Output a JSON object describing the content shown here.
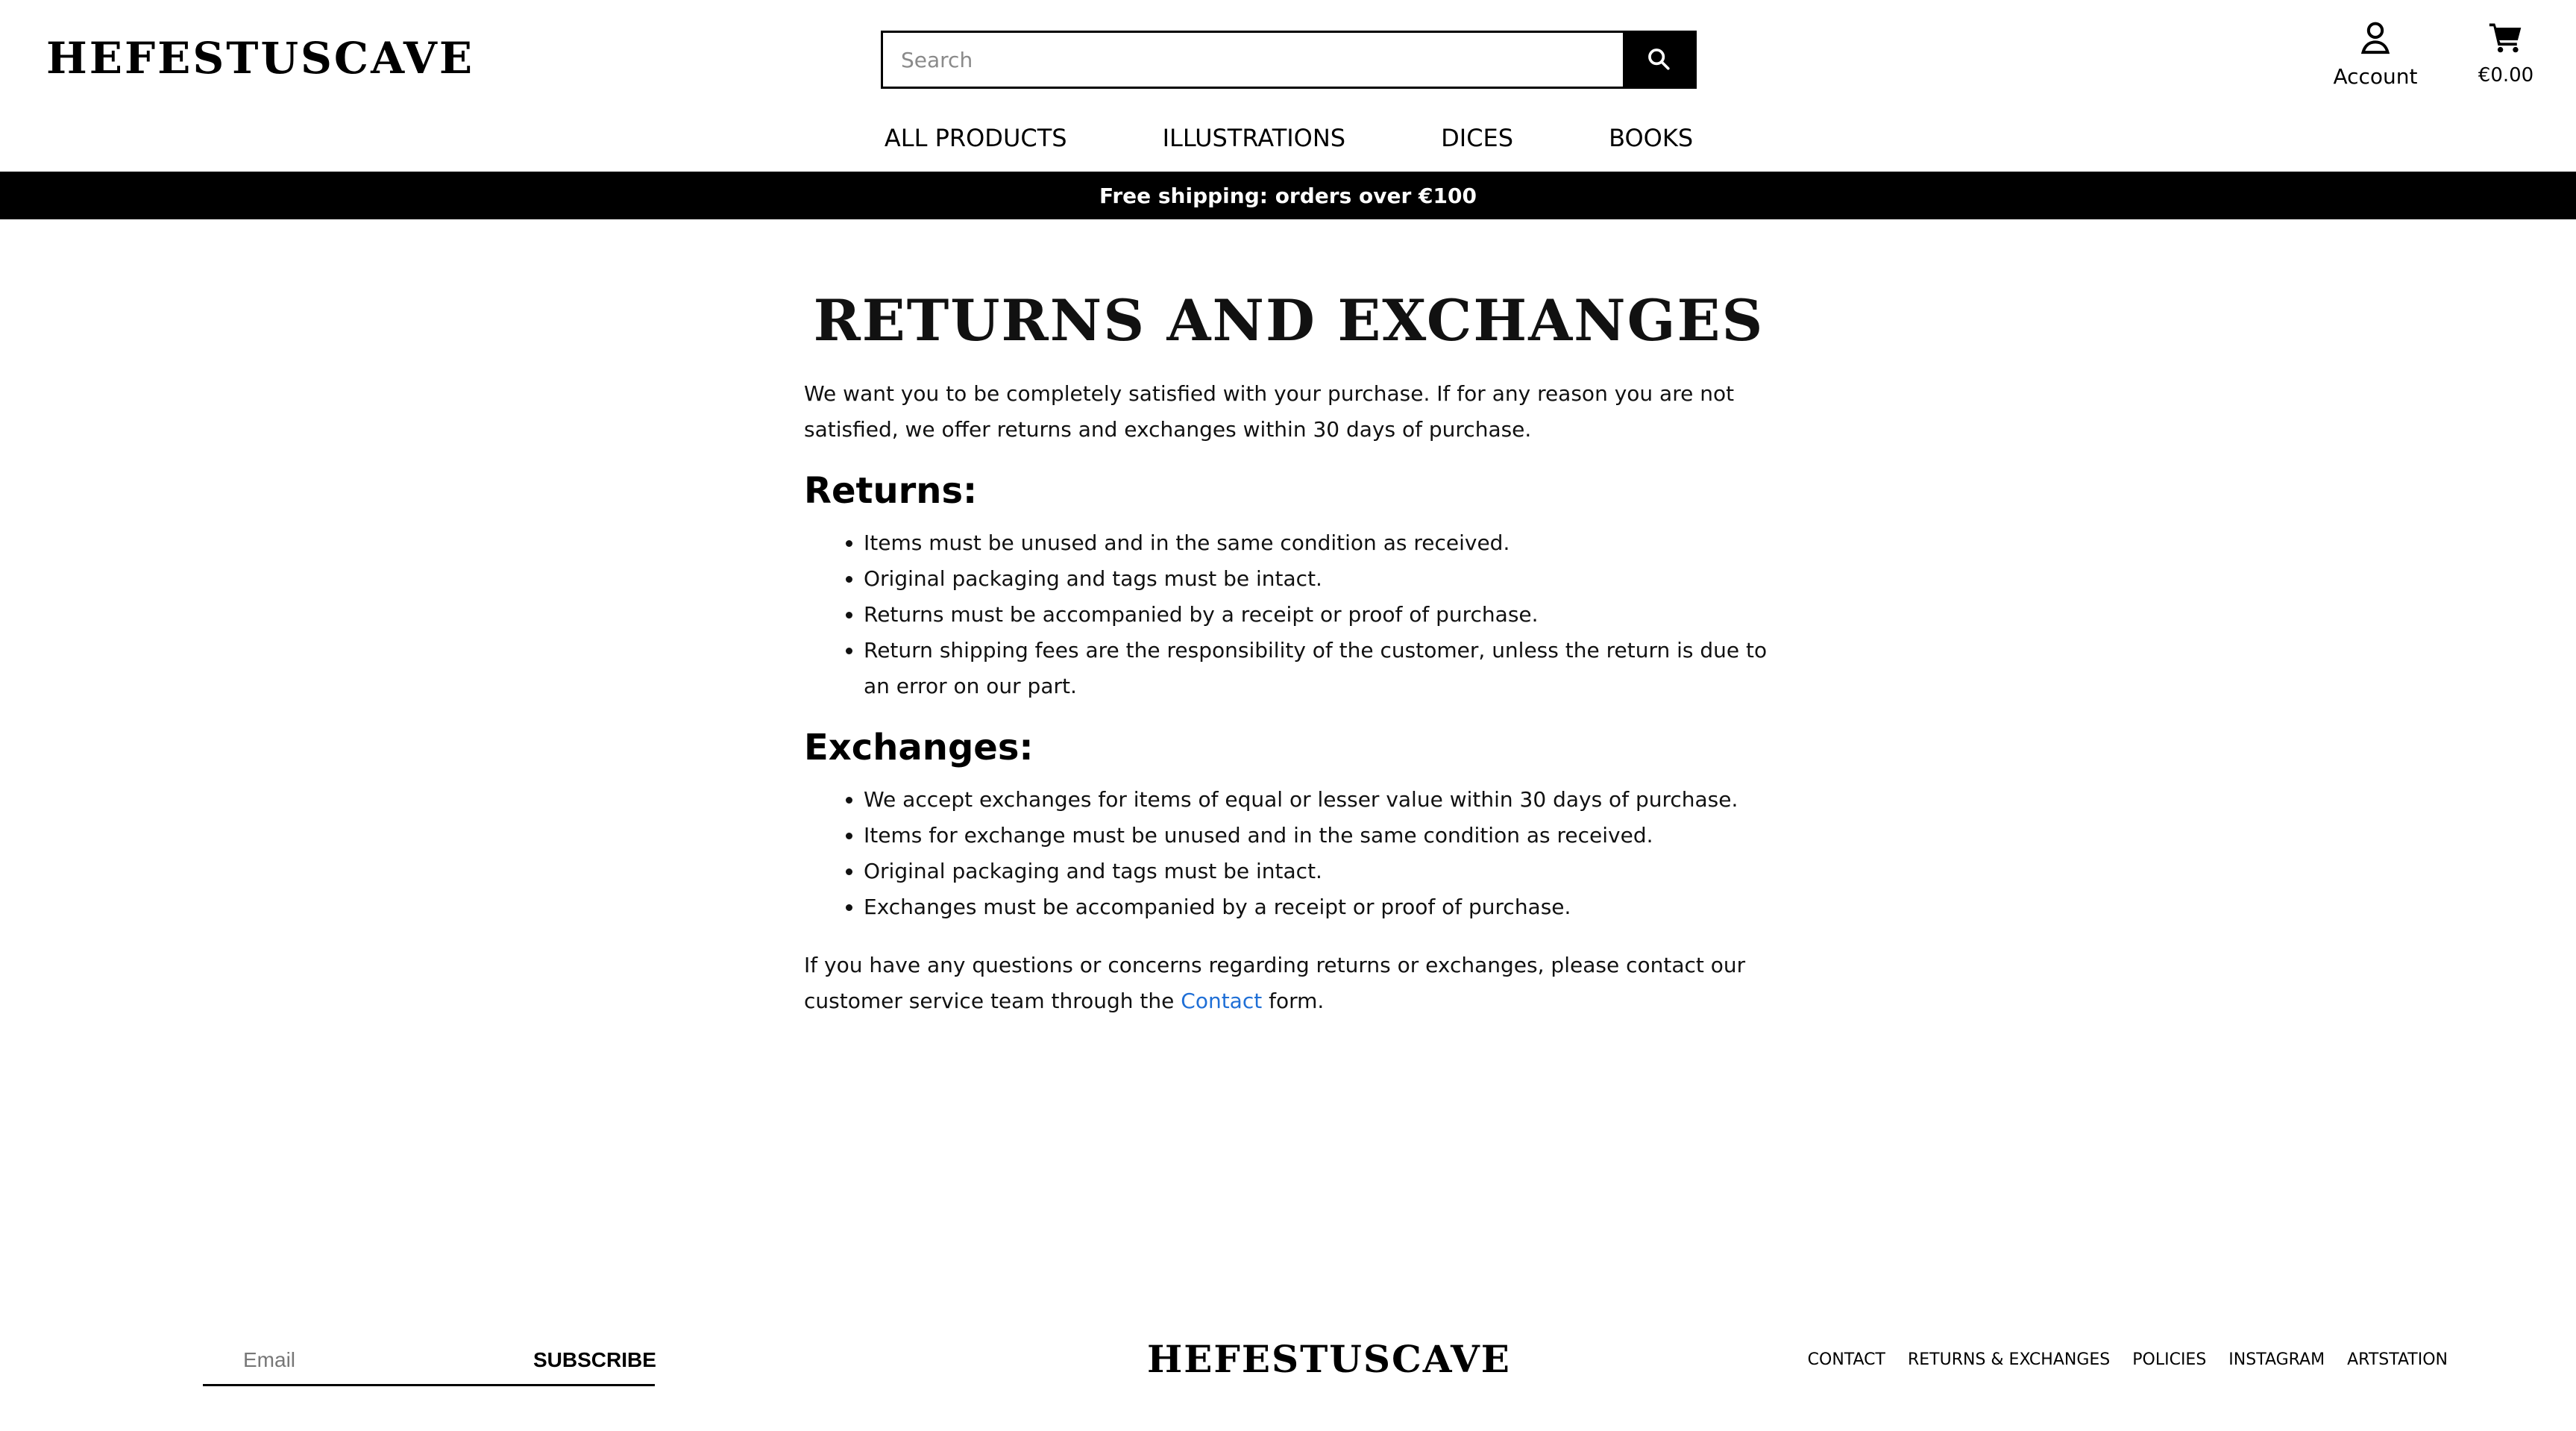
{
  "header": {
    "logo_text": "HEFESTUSCAVE",
    "search": {
      "placeholder": "Search"
    },
    "account_label": "Account",
    "cart_total": "€0.00",
    "nav": [
      {
        "label": "ALL PRODUCTS"
      },
      {
        "label": "ILLUSTRATIONS"
      },
      {
        "label": "DICES"
      },
      {
        "label": "BOOKS"
      }
    ]
  },
  "announcement": {
    "text": "Free shipping: orders over €100"
  },
  "page": {
    "title": "RETURNS AND EXCHANGES",
    "intro": "We want you to be completely satisfied with your purchase. If for any reason you are not satisfied, we offer returns and exchanges within 30 days of purchase.",
    "returns": {
      "heading": "Returns:",
      "items": [
        "Items must be unused and in the same condition as received.",
        "Original packaging and tags must be intact.",
        "Returns must be accompanied by a receipt or proof of purchase.",
        "Return shipping fees are the responsibility of the customer, unless the return is due to an error on our part."
      ]
    },
    "exchanges": {
      "heading": "Exchanges:",
      "items": [
        "We accept exchanges for items of equal or lesser value within 30 days of purchase.",
        "Items for exchange must be unused and in the same condition as received.",
        "Original packaging and tags must be intact.",
        "Exchanges must be accompanied by a receipt or proof of purchase."
      ]
    },
    "outro_prefix": "If you have any questions or concerns regarding returns or exchanges, please contact our customer service team through the ",
    "contact_link": "Contact",
    "outro_suffix": " form."
  },
  "footer": {
    "email_placeholder": "Email",
    "subscribe_label": "SUBSCRIBE",
    "logo_text": "HEFESTUSCAVE",
    "links": [
      {
        "label": "CONTACT"
      },
      {
        "label": "RETURNS & EXCHANGES"
      },
      {
        "label": "POLICIES"
      },
      {
        "label": "INSTAGRAM"
      },
      {
        "label": "ARTSTATION"
      }
    ]
  },
  "colors": {
    "background": "#ffffff",
    "text": "#111111",
    "accent_black": "#000000",
    "link": "#1f6fd6"
  },
  "icons": {
    "search": "search-icon",
    "account": "user-icon",
    "cart": "cart-icon"
  }
}
